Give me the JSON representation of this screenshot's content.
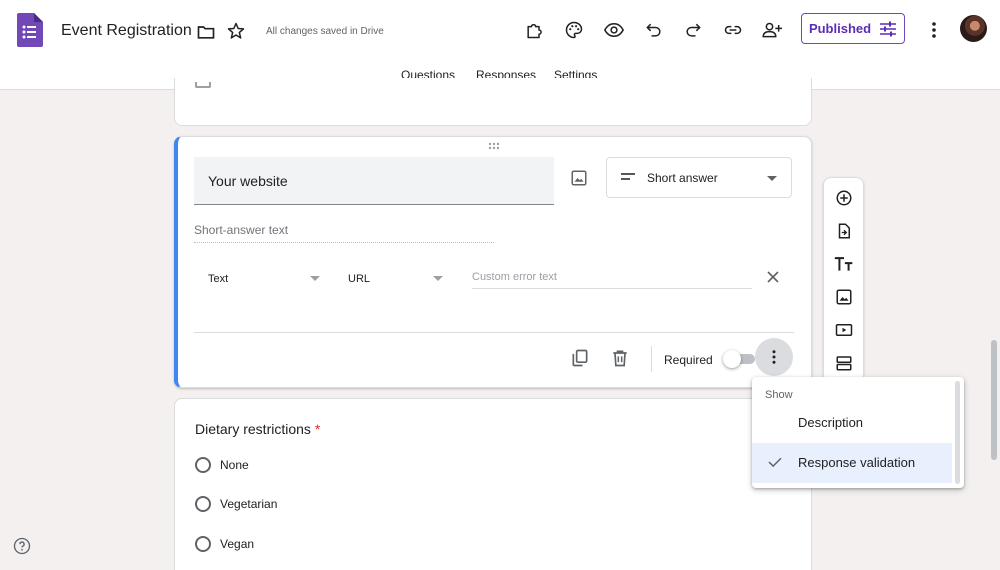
{
  "header": {
    "title": "Event Registration",
    "save_status": "All changes saved in Drive",
    "publish_label": "Published",
    "accent_color": "#5f2bb5"
  },
  "tabs": [
    {
      "label": "Questions",
      "active": true
    },
    {
      "label": "Responses",
      "active": false
    },
    {
      "label": "Settings",
      "active": false
    }
  ],
  "question": {
    "title": "Your website",
    "type_label": "Short answer",
    "answer_hint": "Short-answer text",
    "validation": {
      "rule_type": "Text",
      "rule_subtype": "URL",
      "error_placeholder": "Custom error text"
    },
    "required_label": "Required",
    "required": false
  },
  "dietary": {
    "title": "Dietary restrictions",
    "required_mark": "*",
    "options": [
      "None",
      "Vegetarian",
      "Vegan"
    ]
  },
  "menu": {
    "heading": "Show",
    "items": [
      {
        "label": "Description",
        "checked": false
      },
      {
        "label": "Response validation",
        "checked": true
      }
    ]
  },
  "icons": {
    "header": [
      "folder-icon",
      "star-icon",
      "addons-icon",
      "palette-icon",
      "preview-icon",
      "undo-icon",
      "redo-icon",
      "link-icon",
      "add-collaborator-icon",
      "settings-sliders-icon",
      "more-vert-icon"
    ],
    "toolbar": [
      "add-question-icon",
      "import-questions-icon",
      "add-title-icon",
      "add-image-icon",
      "add-video-icon",
      "add-section-icon"
    ]
  }
}
